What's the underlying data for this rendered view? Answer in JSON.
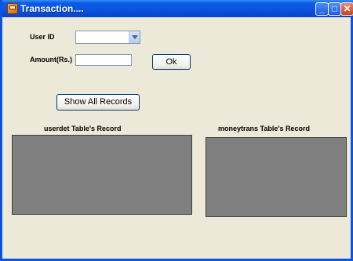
{
  "window": {
    "title": "Transaction....",
    "minimize_glyph": "_",
    "maximize_glyph": "□",
    "close_glyph": "✕"
  },
  "form": {
    "user_id_label": "User ID",
    "user_id_value": "",
    "amount_label": "Amount(Rs.)",
    "amount_value": "",
    "ok_label": "Ok",
    "show_all_label": "Show All Records"
  },
  "grids": {
    "userdet_header": "userdet Table's Record",
    "moneytrans_header": "moneytrans Table's Record"
  },
  "colors": {
    "titlebar": "#0A55E0",
    "window_bg": "#ECE9D8",
    "grid_bg": "#808080"
  }
}
